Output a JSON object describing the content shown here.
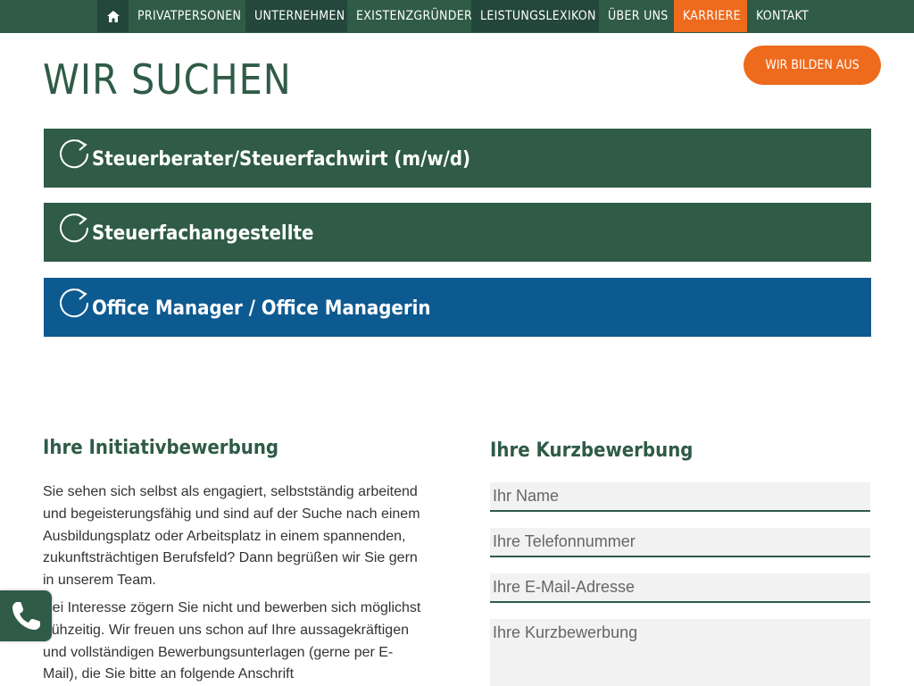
{
  "nav": {
    "home_icon": "home-icon",
    "items": [
      {
        "label": "PRIVATPERSONEN"
      },
      {
        "label": "UNTERNEHMEN"
      },
      {
        "label": "EXISTENZGRÜNDER"
      },
      {
        "label": "LEISTUNGSLEXIKON"
      },
      {
        "label": "ÜBER UNS"
      },
      {
        "label": "KARRIERE"
      },
      {
        "label": "KONTAKT"
      }
    ]
  },
  "page": {
    "title": "WIR SUCHEN",
    "cta_label": "WIR BILDEN AUS"
  },
  "jobs": [
    {
      "label": "Steuerberater/Steuerfachwirt (m/w/d)",
      "icon": "refresh-icon"
    },
    {
      "label": "Steuerfachangestellte",
      "icon": "refresh-icon"
    },
    {
      "label": "Office Manager / Office Managerin",
      "icon": "refresh-icon"
    }
  ],
  "initiative": {
    "heading": "Ihre Initiativbewerbung",
    "paragraph1": "Sie sehen sich selbst als engagiert, selbstständig arbeitend und begeisterungsfähig und sind auf der Suche nach einem Ausbildungsplatz oder Arbeitsplatz in einem spannenden, zukunftsträchtigen Berufsfeld? Dann begrüßen wir Sie gern in unserem Team.",
    "paragraph2": "Bei Interesse zögern Sie nicht und bewerben sich mög­lichst frühzeitig. Wir freuen uns schon auf Ihre aussage­kräftigen und vollständigen Bewerbungsunterlagen (gerne per E-Mail), die Sie bitte an folgende Anschrift"
  },
  "form": {
    "heading": "Ihre Kurzbewerbung",
    "name_placeholder": "Ihr Name",
    "phone_placeholder": "Ihre Telefonnummer",
    "email_placeholder": "Ihre E-Mail-Adresse",
    "message_placeholder": "Ihre Kurzbewerbung"
  },
  "colors": {
    "brand_green": "#2f5b47",
    "accent_orange": "#ee6a1c",
    "accent_blue": "#0d5a91"
  },
  "phone_button_icon": "phone-icon"
}
